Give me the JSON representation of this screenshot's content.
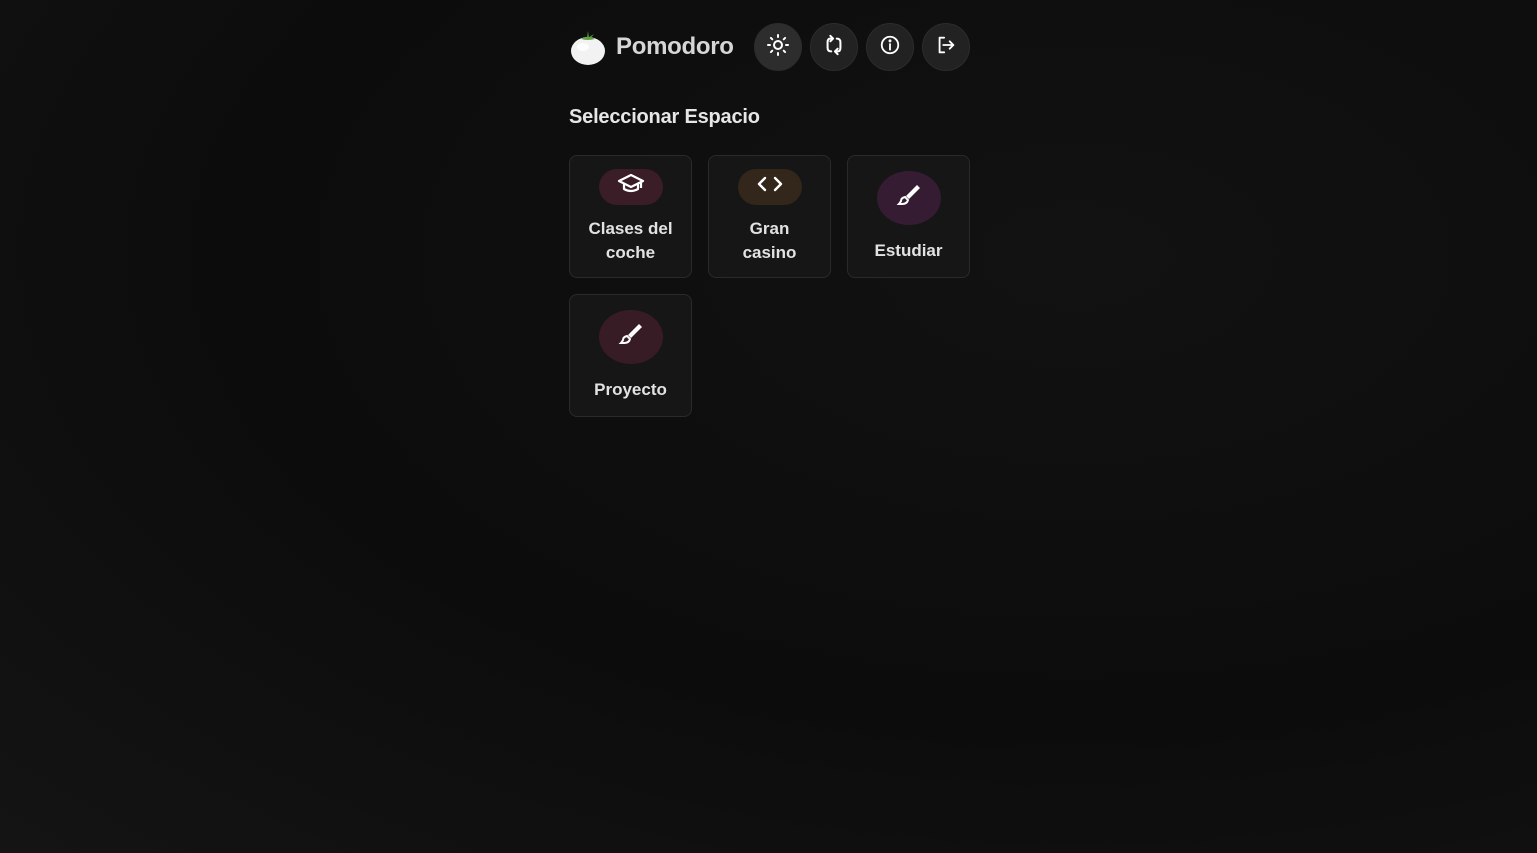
{
  "app": {
    "brand_name": "Pomodoro",
    "logo_icon": "tomato-icon"
  },
  "toolbar": [
    {
      "name": "theme-toggle-button",
      "icon": "sun-icon"
    },
    {
      "name": "sync-button",
      "icon": "refresh-icon"
    },
    {
      "name": "info-button",
      "icon": "info-icon"
    },
    {
      "name": "logout-button",
      "icon": "logout-icon"
    }
  ],
  "section": {
    "title": "Seleccionar Espacio"
  },
  "spaces": [
    {
      "label": "Clases del coche",
      "icon": "graduation-cap-icon",
      "icon_bg": "#3a1d26"
    },
    {
      "label": "Gran casino",
      "icon": "code-icon",
      "icon_bg": "#33261a"
    },
    {
      "label": "Estudiar",
      "icon": "brush-icon",
      "icon_bg": "#351c33"
    },
    {
      "label": "Proyecto",
      "icon": "brush-icon",
      "icon_bg": "#371c26"
    }
  ],
  "colors": {
    "background": "#0e0e0e",
    "card": "#161616",
    "toolbar_button": "#222222",
    "text": "#e2e2e2"
  }
}
